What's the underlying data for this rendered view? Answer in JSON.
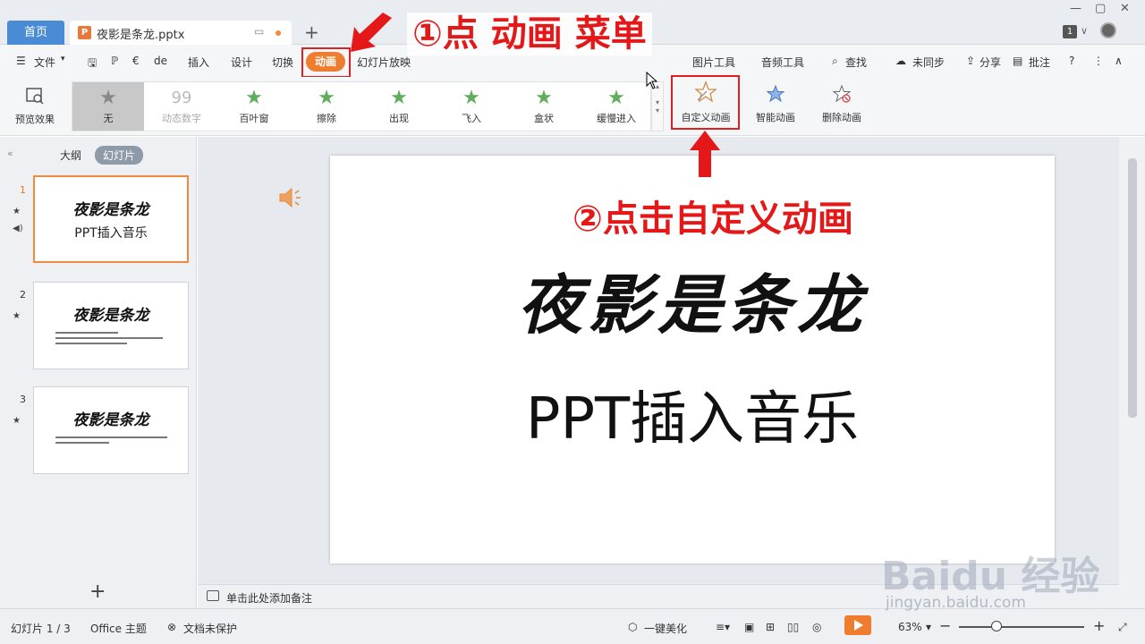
{
  "titlebar": {
    "home_tab": "首页",
    "doc_tab": "夜影是条龙.pptx",
    "new_tab": "+",
    "account_badge": "1"
  },
  "menu": {
    "items": [
      "文件",
      "de",
      "插入",
      "设计",
      "切换",
      "动画",
      "幻灯片放映",
      "图片工具",
      "音频工具",
      "查找",
      "未同步",
      "分享",
      "批注"
    ],
    "active": "动画"
  },
  "ribbon": {
    "preview": "预览效果",
    "gallery": [
      "无",
      "动态数字",
      "百叶窗",
      "擦除",
      "出现",
      "飞入",
      "盒状",
      "缓慢进入"
    ],
    "custom_animation": "自定义动画",
    "smart_animation": "智能动画",
    "delete_animation": "删除动画"
  },
  "leftpanel": {
    "tab_outline": "大纲",
    "tab_slides": "幻灯片",
    "slides": [
      {
        "num": "1",
        "title": "夜影是条龙",
        "sub": "PPT插入音乐"
      },
      {
        "num": "2",
        "title": "夜影是条龙"
      },
      {
        "num": "3",
        "title": "夜影是条龙"
      }
    ],
    "add": "+"
  },
  "slide": {
    "title": "夜影是条龙",
    "subtitle": "PPT插入音乐"
  },
  "notes": {
    "placeholder": "单击此处添加备注"
  },
  "statusbar": {
    "slide_info": "幻灯片 1 / 3",
    "theme": "Office 主题",
    "protect": "文档未保护",
    "beautify": "一键美化",
    "zoom": "63%"
  },
  "annotations": {
    "step1": "①点  动画  菜单",
    "step2": "②点击自定义动画"
  },
  "watermark": {
    "logo": "Baidu 经验",
    "url": "jingyan.baidu.com"
  },
  "colors": {
    "accent": "#ee7d2f",
    "annotation": "#e41818",
    "home_tab": "#4a8bd6"
  }
}
